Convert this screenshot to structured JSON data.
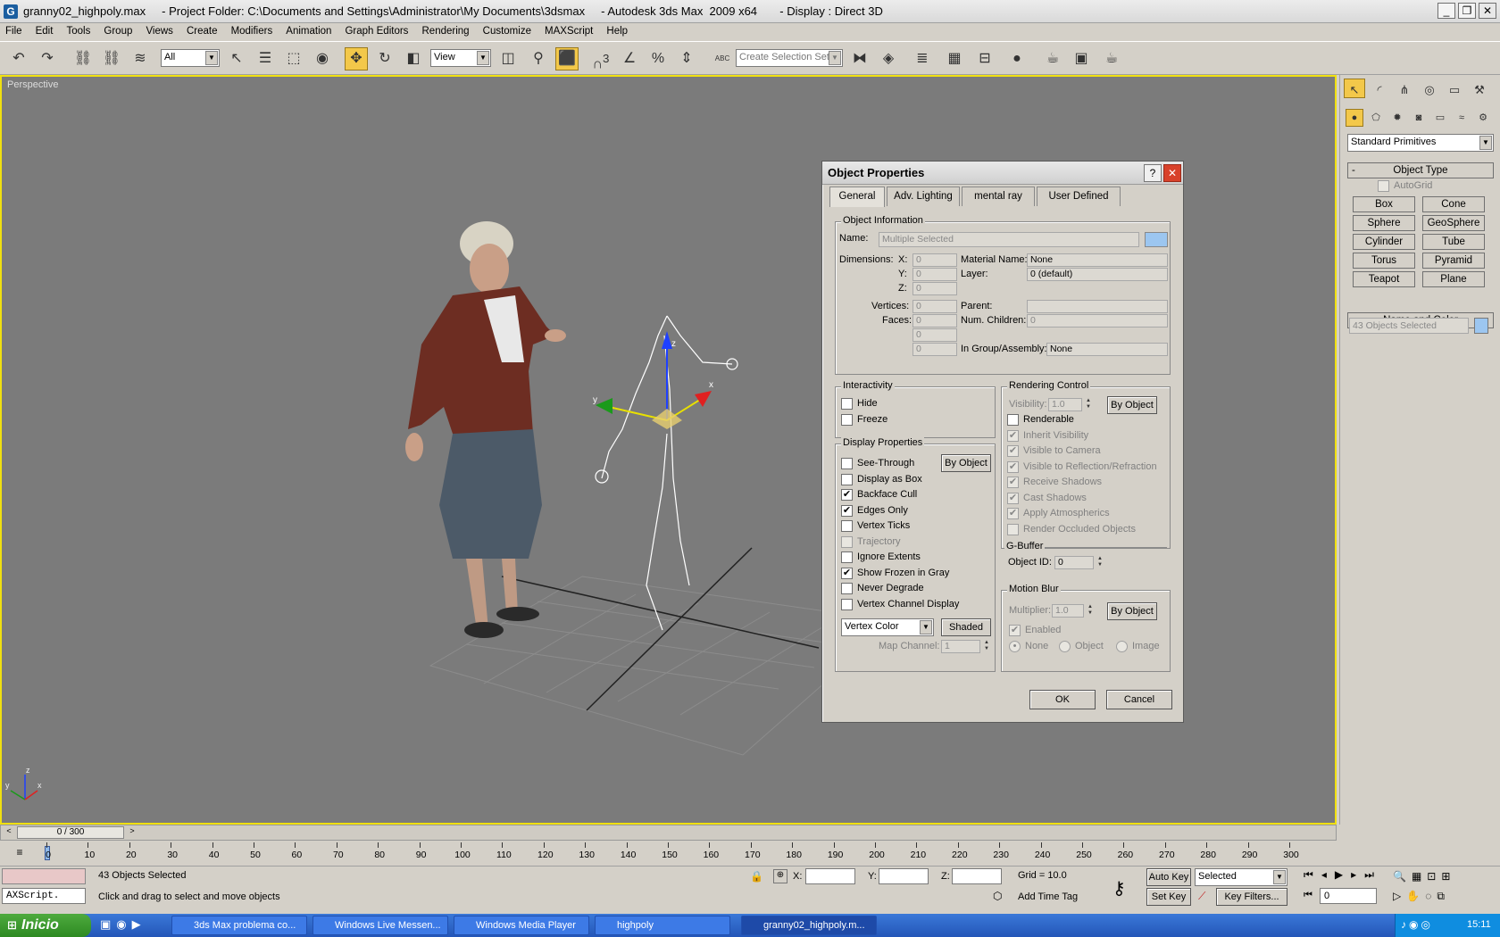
{
  "window": {
    "title": "granny02_highpoly.max     - Project Folder: C:\\Documents and Settings\\Administrator\\My Documents\\3dsmax     - Autodesk 3ds Max  2009 x64       - Display : Direct 3D"
  },
  "menu": [
    "File",
    "Edit",
    "Tools",
    "Group",
    "Views",
    "Create",
    "Modifiers",
    "Animation",
    "Graph Editors",
    "Rendering",
    "Customize",
    "MAXScript",
    "Help"
  ],
  "toolbar": {
    "filter_value": "All",
    "refcoord_value": "View",
    "selection_set_placeholder": "Create Selection Set",
    "snap_count": "3",
    "abc_label": "ABC"
  },
  "viewport": {
    "label": "Perspective",
    "axis_labels": {
      "x": "x",
      "y": "y",
      "z": "z"
    }
  },
  "command_panel": {
    "category_dropdown": "Standard Primitives",
    "object_type_header": "Object Type",
    "autogrid_label": "AutoGrid",
    "primitives": [
      "Box",
      "Cone",
      "Sphere",
      "GeoSphere",
      "Cylinder",
      "Tube",
      "Torus",
      "Pyramid",
      "Teapot",
      "Plane"
    ],
    "name_color_header": "Name and Color",
    "name_value": "43 Objects Selected",
    "swatch_color": "#9cc6f0"
  },
  "dialog": {
    "title": "Object Properties",
    "tabs": [
      "General",
      "Adv. Lighting",
      "mental ray",
      "User Defined"
    ],
    "object_info": {
      "label": "Object Information",
      "name_label": "Name:",
      "name_value": "Multiple Selected",
      "dimensions_label": "Dimensions:",
      "x_label": "X:",
      "y_label": "Y:",
      "z_label": "Z:",
      "x_value": "0",
      "y_value": "0",
      "z_value": "0",
      "vertices_label": "Vertices:",
      "vertices_value": "0",
      "faces_label": "Faces:",
      "faces_value": "0",
      "extra1": "0",
      "extra2": "0",
      "material_label": "Material Name:",
      "material_value": "None",
      "layer_label": "Layer:",
      "layer_value": "0 (default)",
      "parent_label": "Parent:",
      "parent_value": "",
      "children_label": "Num. Children:",
      "children_value": "0",
      "group_label": "In Group/Assembly:",
      "group_value": "None"
    },
    "interactivity": {
      "label": "Interactivity",
      "hide": "Hide",
      "freeze": "Freeze"
    },
    "display": {
      "label": "Display Properties",
      "by_object": "By Object",
      "items": [
        "See-Through",
        "Display as Box",
        "Backface Cull",
        "Edges Only",
        "Vertex Ticks",
        "Trajectory",
        "Ignore Extents",
        "Show Frozen in Gray",
        "Never Degrade",
        "Vertex Channel Display"
      ],
      "checked": [
        false,
        false,
        true,
        true,
        false,
        false,
        false,
        true,
        false,
        false
      ],
      "disabled": [
        false,
        false,
        false,
        false,
        false,
        true,
        false,
        false,
        false,
        false
      ],
      "vertex_color": "Vertex Color",
      "shaded": "Shaded",
      "map_channel_label": "Map Channel:",
      "map_channel_value": "1"
    },
    "rendering": {
      "label": "Rendering Control",
      "visibility_label": "Visibility:",
      "visibility_value": "1.0",
      "by_object": "By Object",
      "items": [
        "Renderable",
        "Inherit Visibility",
        "Visible to Camera",
        "Visible to Reflection/Refraction",
        "Receive Shadows",
        "Cast Shadows",
        "Apply Atmospherics",
        "Render Occluded Objects"
      ],
      "checked": [
        false,
        true,
        true,
        true,
        true,
        true,
        true,
        false
      ],
      "disabled": [
        false,
        true,
        true,
        true,
        true,
        true,
        true,
        true
      ]
    },
    "gbuffer": {
      "label": "G-Buffer",
      "objectid_label": "Object ID:",
      "objectid_value": "0"
    },
    "motion_blur": {
      "label": "Motion Blur",
      "multiplier_label": "Multiplier:",
      "multiplier_value": "1.0",
      "by_object": "By Object",
      "enabled": "Enabled",
      "none": "None",
      "object": "Object",
      "image": "Image"
    },
    "ok": "OK",
    "cancel": "Cancel"
  },
  "timeline": {
    "slider_label": "0 / 300",
    "ticks": [
      "0",
      "10",
      "20",
      "30",
      "40",
      "50",
      "60",
      "70",
      "80",
      "90",
      "100",
      "110",
      "120",
      "130",
      "140",
      "150",
      "160",
      "170",
      "180",
      "190",
      "200",
      "210",
      "220",
      "230",
      "240",
      "250",
      "260",
      "270",
      "280",
      "290",
      "300"
    ]
  },
  "status": {
    "script_label": "AXScript.",
    "selected_count": "43 Objects Selected",
    "prompt": "Click and drag to select and move objects",
    "x_label": "X:",
    "y_label": "Y:",
    "z_label": "Z:",
    "grid": "Grid = 10.0",
    "add_time_tag": "Add Time Tag",
    "auto_key": "Auto Key",
    "set_key": "Set Key",
    "selected_dropdown": "Selected",
    "key_filters": "Key Filters...",
    "frame_value": "0"
  },
  "taskbar": {
    "start": "Inicio",
    "tasks": [
      "3ds Max problema co...",
      "Windows Live Messen...",
      "Windows Media Player",
      "highpoly",
      "granny02_highpoly.m..."
    ],
    "clock": "15:11"
  }
}
